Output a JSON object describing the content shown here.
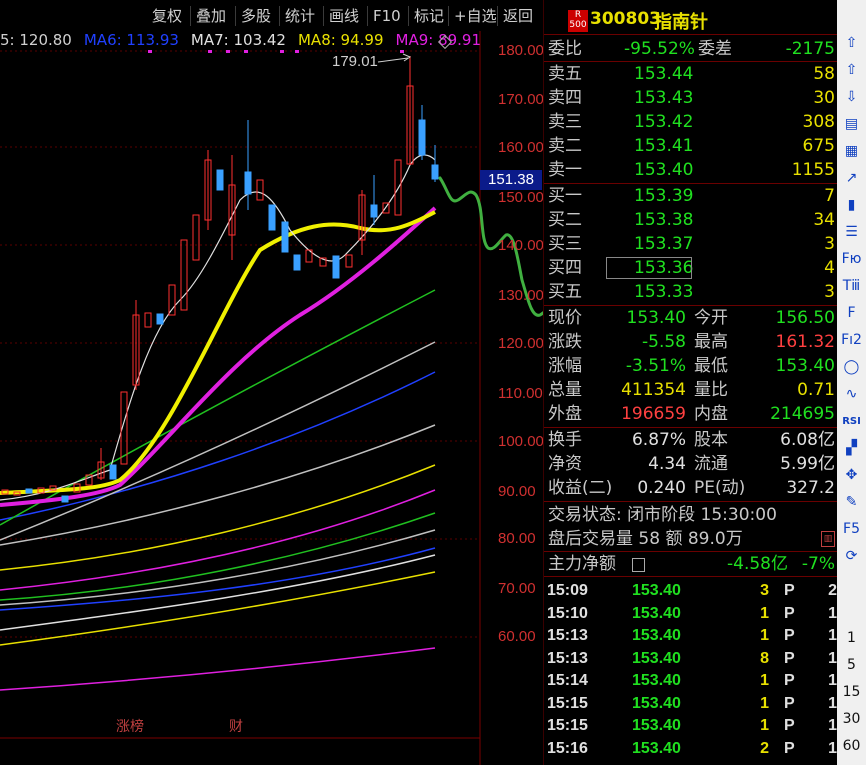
{
  "toolbar": {
    "buttons": [
      "复权",
      "叠加",
      "多股",
      "统计",
      "画线",
      "F10",
      "标记",
      "+自选",
      "返回"
    ]
  },
  "ma_legend": [
    {
      "label": "5: 120.80",
      "color": "#d0d0d0"
    },
    {
      "label": "MA6: 113.93",
      "color": "#2040ff"
    },
    {
      "label": "MA7: 103.42",
      "color": "#e0e0e0"
    },
    {
      "label": "MA8: 94.99",
      "color": "#e8e000"
    },
    {
      "label": "MA9: 89.91",
      "color": "#e020e0"
    }
  ],
  "chart": {
    "y_labels": [
      "180.00",
      "170.00",
      "160.00",
      "150.00",
      "140.00",
      "130.00",
      "120.00",
      "110.00",
      "100.00",
      "90.00",
      "80.00",
      "70.00",
      "60.00"
    ],
    "peak_label": "179.01",
    "current_price_tag": "151.38",
    "event_tags": [
      "涨榜",
      "财"
    ]
  },
  "stock": {
    "market_badge": "R",
    "market_badge_sub": "500",
    "code": "300803",
    "name": "指南针"
  },
  "order_ratio": {
    "label_ratio": "委比",
    "ratio": "-95.52%",
    "label_diff": "委差",
    "diff": "-2175"
  },
  "asks": [
    {
      "label": "卖五",
      "price": "153.44",
      "vol": "58"
    },
    {
      "label": "卖四",
      "price": "153.43",
      "vol": "30"
    },
    {
      "label": "卖三",
      "price": "153.42",
      "vol": "308"
    },
    {
      "label": "卖二",
      "price": "153.41",
      "vol": "675"
    },
    {
      "label": "卖一",
      "price": "153.40",
      "vol": "1155"
    }
  ],
  "bids": [
    {
      "label": "买一",
      "price": "153.39",
      "vol": "7"
    },
    {
      "label": "买二",
      "price": "153.38",
      "vol": "34"
    },
    {
      "label": "买三",
      "price": "153.37",
      "vol": "3"
    },
    {
      "label": "买四",
      "price": "153.36",
      "vol": "4"
    },
    {
      "label": "买五",
      "price": "153.33",
      "vol": "3"
    }
  ],
  "quote": [
    {
      "l1": "现价",
      "v1": "153.40",
      "l2": "今开",
      "v2": "156.50",
      "c1": "g",
      "c2": "g"
    },
    {
      "l1": "涨跌",
      "v1": "-5.58",
      "l2": "最高",
      "v2": "161.32",
      "c1": "g",
      "c2": "r"
    },
    {
      "l1": "涨幅",
      "v1": "-3.51%",
      "l2": "最低",
      "v2": "153.40",
      "c1": "g",
      "c2": "g"
    },
    {
      "l1": "总量",
      "v1": "411354",
      "l2": "量比",
      "v2": "0.71",
      "c1": "y",
      "c2": "y"
    },
    {
      "l1": "外盘",
      "v1": "196659",
      "l2": "内盘",
      "v2": "214695",
      "c1": "r",
      "c2": "g"
    }
  ],
  "finance": [
    {
      "l1": "换手",
      "v1": "6.87%",
      "l2": "股本",
      "v2": "6.08亿"
    },
    {
      "l1": "净资",
      "v1": "4.34",
      "l2": "流通",
      "v2": "5.99亿"
    },
    {
      "l1": "收益(二)",
      "v1": "0.240",
      "l2": "PE(动)",
      "v2": "327.2"
    }
  ],
  "status": {
    "trade_state": "交易状态: 闭市阶段 15:30:00",
    "after_hours": "盘后交易量 58 额 89.0万"
  },
  "main_flow": {
    "label": "主力净额",
    "value": "-4.58亿",
    "pct": "-7%"
  },
  "ticks": [
    {
      "time": "15:09",
      "price": "153.40",
      "vol": "3",
      "flag": "P",
      "n": "2"
    },
    {
      "time": "15:10",
      "price": "153.40",
      "vol": "1",
      "flag": "P",
      "n": "1"
    },
    {
      "time": "15:13",
      "price": "153.40",
      "vol": "1",
      "flag": "P",
      "n": "1"
    },
    {
      "time": "15:13",
      "price": "153.40",
      "vol": "8",
      "flag": "P",
      "n": "1"
    },
    {
      "time": "15:14",
      "price": "153.40",
      "vol": "1",
      "flag": "P",
      "n": "1"
    },
    {
      "time": "15:15",
      "price": "153.40",
      "vol": "1",
      "flag": "P",
      "n": "1"
    },
    {
      "time": "15:15",
      "price": "153.40",
      "vol": "1",
      "flag": "P",
      "n": "1"
    },
    {
      "time": "15:16",
      "price": "153.40",
      "vol": "2",
      "flag": "P",
      "n": "1"
    }
  ],
  "side_toolbar": {
    "icons": [
      "arrow-up-icon",
      "arrow-up-outline-icon",
      "arrow-down-outline-icon",
      "report-icon",
      "grid-icon",
      "line-chart-icon",
      "candle-icon",
      "list-icon",
      "f10-icon",
      "tf-icon",
      "f-icon",
      "f12-icon",
      "circle-icon",
      "wave-icon",
      "rsi-icon",
      "mosaic-icon",
      "move-icon",
      "pencil-icon",
      "f5-icon",
      "refresh-icon"
    ],
    "icon_glyphs": [
      "⇧",
      "⇧",
      "⇩",
      "▤",
      "▦",
      "↗",
      "▮",
      "☰",
      "Fю",
      "Tⅲ",
      "F",
      "Fı2",
      "◯",
      "∿",
      "RSI",
      "▞",
      "✥",
      "✎",
      "F5",
      "⟳"
    ],
    "periods": [
      "1",
      "5",
      "15",
      "30",
      "60"
    ]
  }
}
